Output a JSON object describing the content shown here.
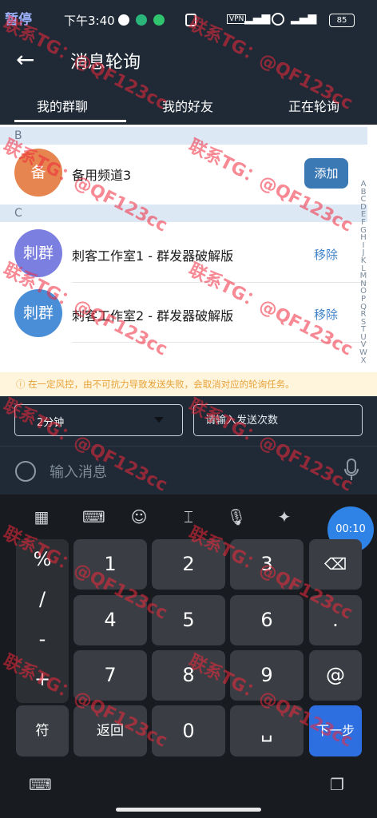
{
  "status_bar": {
    "pause_label": "暂停",
    "time": "下午3:40",
    "battery": "85"
  },
  "header": {
    "title": "消息轮询"
  },
  "tabs": [
    {
      "label": "我的群聊"
    },
    {
      "label": "我的好友"
    },
    {
      "label": "正在轮询"
    }
  ],
  "sections": [
    {
      "letter": "B",
      "items": [
        {
          "avatar": "备",
          "name": "备用频道3",
          "action": "添加",
          "color": "#e6854f"
        }
      ]
    },
    {
      "letter": "C",
      "items": [
        {
          "avatar": "刺群",
          "name": "刺客工作室1 - 群发器破解版",
          "action": "移除",
          "color": "#7b7fe0"
        },
        {
          "avatar": "刺群",
          "name": "刺客工作室2 - 群发器破解版",
          "action": "移除",
          "color": "#4b8ed8"
        }
      ]
    }
  ],
  "alphabet": [
    "A",
    "B",
    "C",
    "D",
    "E",
    "F",
    "G",
    "H",
    "I",
    "J",
    "K",
    "L",
    "M",
    "N",
    "O",
    "P",
    "Q",
    "R",
    "S",
    "T",
    "U",
    "V",
    "W",
    "X"
  ],
  "notice": "ⓘ 在一定风控，由不可抗力导致发送失败，会取消对应的轮询任务。",
  "controls": {
    "interval_value": "2分钟",
    "count_placeholder": "请输入发送次数"
  },
  "compose": {
    "placeholder": "输入消息"
  },
  "keyboard": {
    "timer": "00:10",
    "symbol_keys": [
      "%",
      "/",
      "-",
      "+"
    ],
    "digits": [
      "1",
      "2",
      "3",
      "4",
      "5",
      "6",
      "7",
      "8",
      "9",
      "0"
    ],
    "dot": ".",
    "at": "@",
    "fu": "符",
    "back_label": "返回",
    "next_label": "下一步"
  },
  "watermark": "联系TG：@QF123cc"
}
